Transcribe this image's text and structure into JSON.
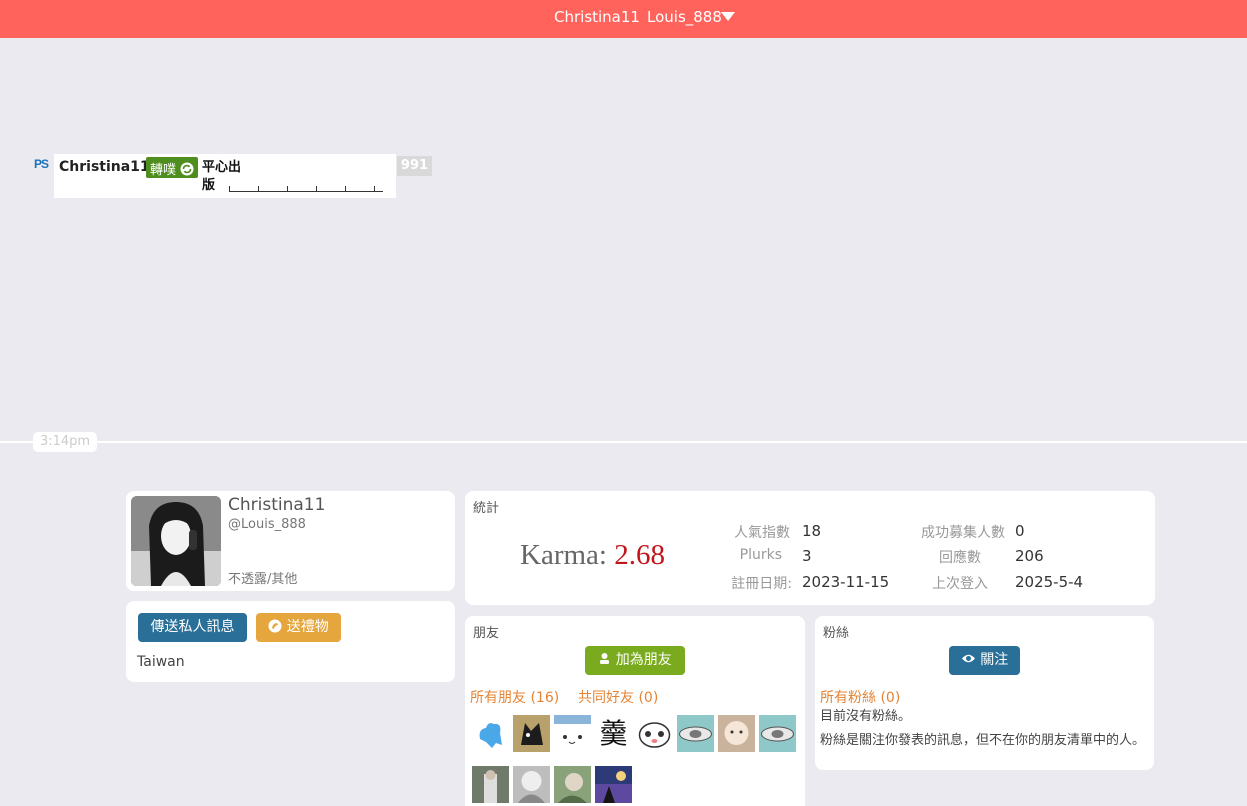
{
  "header": {
    "display_name": "Christina11",
    "username": "Louis_888"
  },
  "timeline": {
    "plurk": {
      "author": "Christina11",
      "replurk_label": "轉噗",
      "content": "平心出版",
      "response_count": "991"
    },
    "time": "3:14pm"
  },
  "profile": {
    "display_name": "Christina11",
    "handle": "@Louis_888",
    "meta": "不透露/其他",
    "location": "Taiwan",
    "actions": {
      "message": "傳送私人訊息",
      "gift": "送禮物"
    }
  },
  "stats": {
    "title": "統計",
    "karma_label": "Karma:",
    "karma_value": "2.68",
    "items": [
      {
        "label": "人氣指數",
        "value": "18"
      },
      {
        "label": "Plurks",
        "value": "3"
      },
      {
        "label": "註冊日期:",
        "value": "2023-11-15"
      },
      {
        "label": "成功募集人數",
        "value": "0"
      },
      {
        "label": "回應數",
        "value": "206"
      },
      {
        "label": "上次登入",
        "value": "2025-5-4"
      }
    ]
  },
  "friends": {
    "title": "朋友",
    "add_button": "加為朋友",
    "all_friends": "所有朋友 (16)",
    "mutual": "共同好友 (0)"
  },
  "fans": {
    "title": "粉絲",
    "follow_button": "關注",
    "all_fans": "所有粉絲 (0)",
    "empty": "目前沒有粉絲。",
    "description": "粉絲是關注你發表的訊息，但不在你的朋友清單中的人。"
  }
}
